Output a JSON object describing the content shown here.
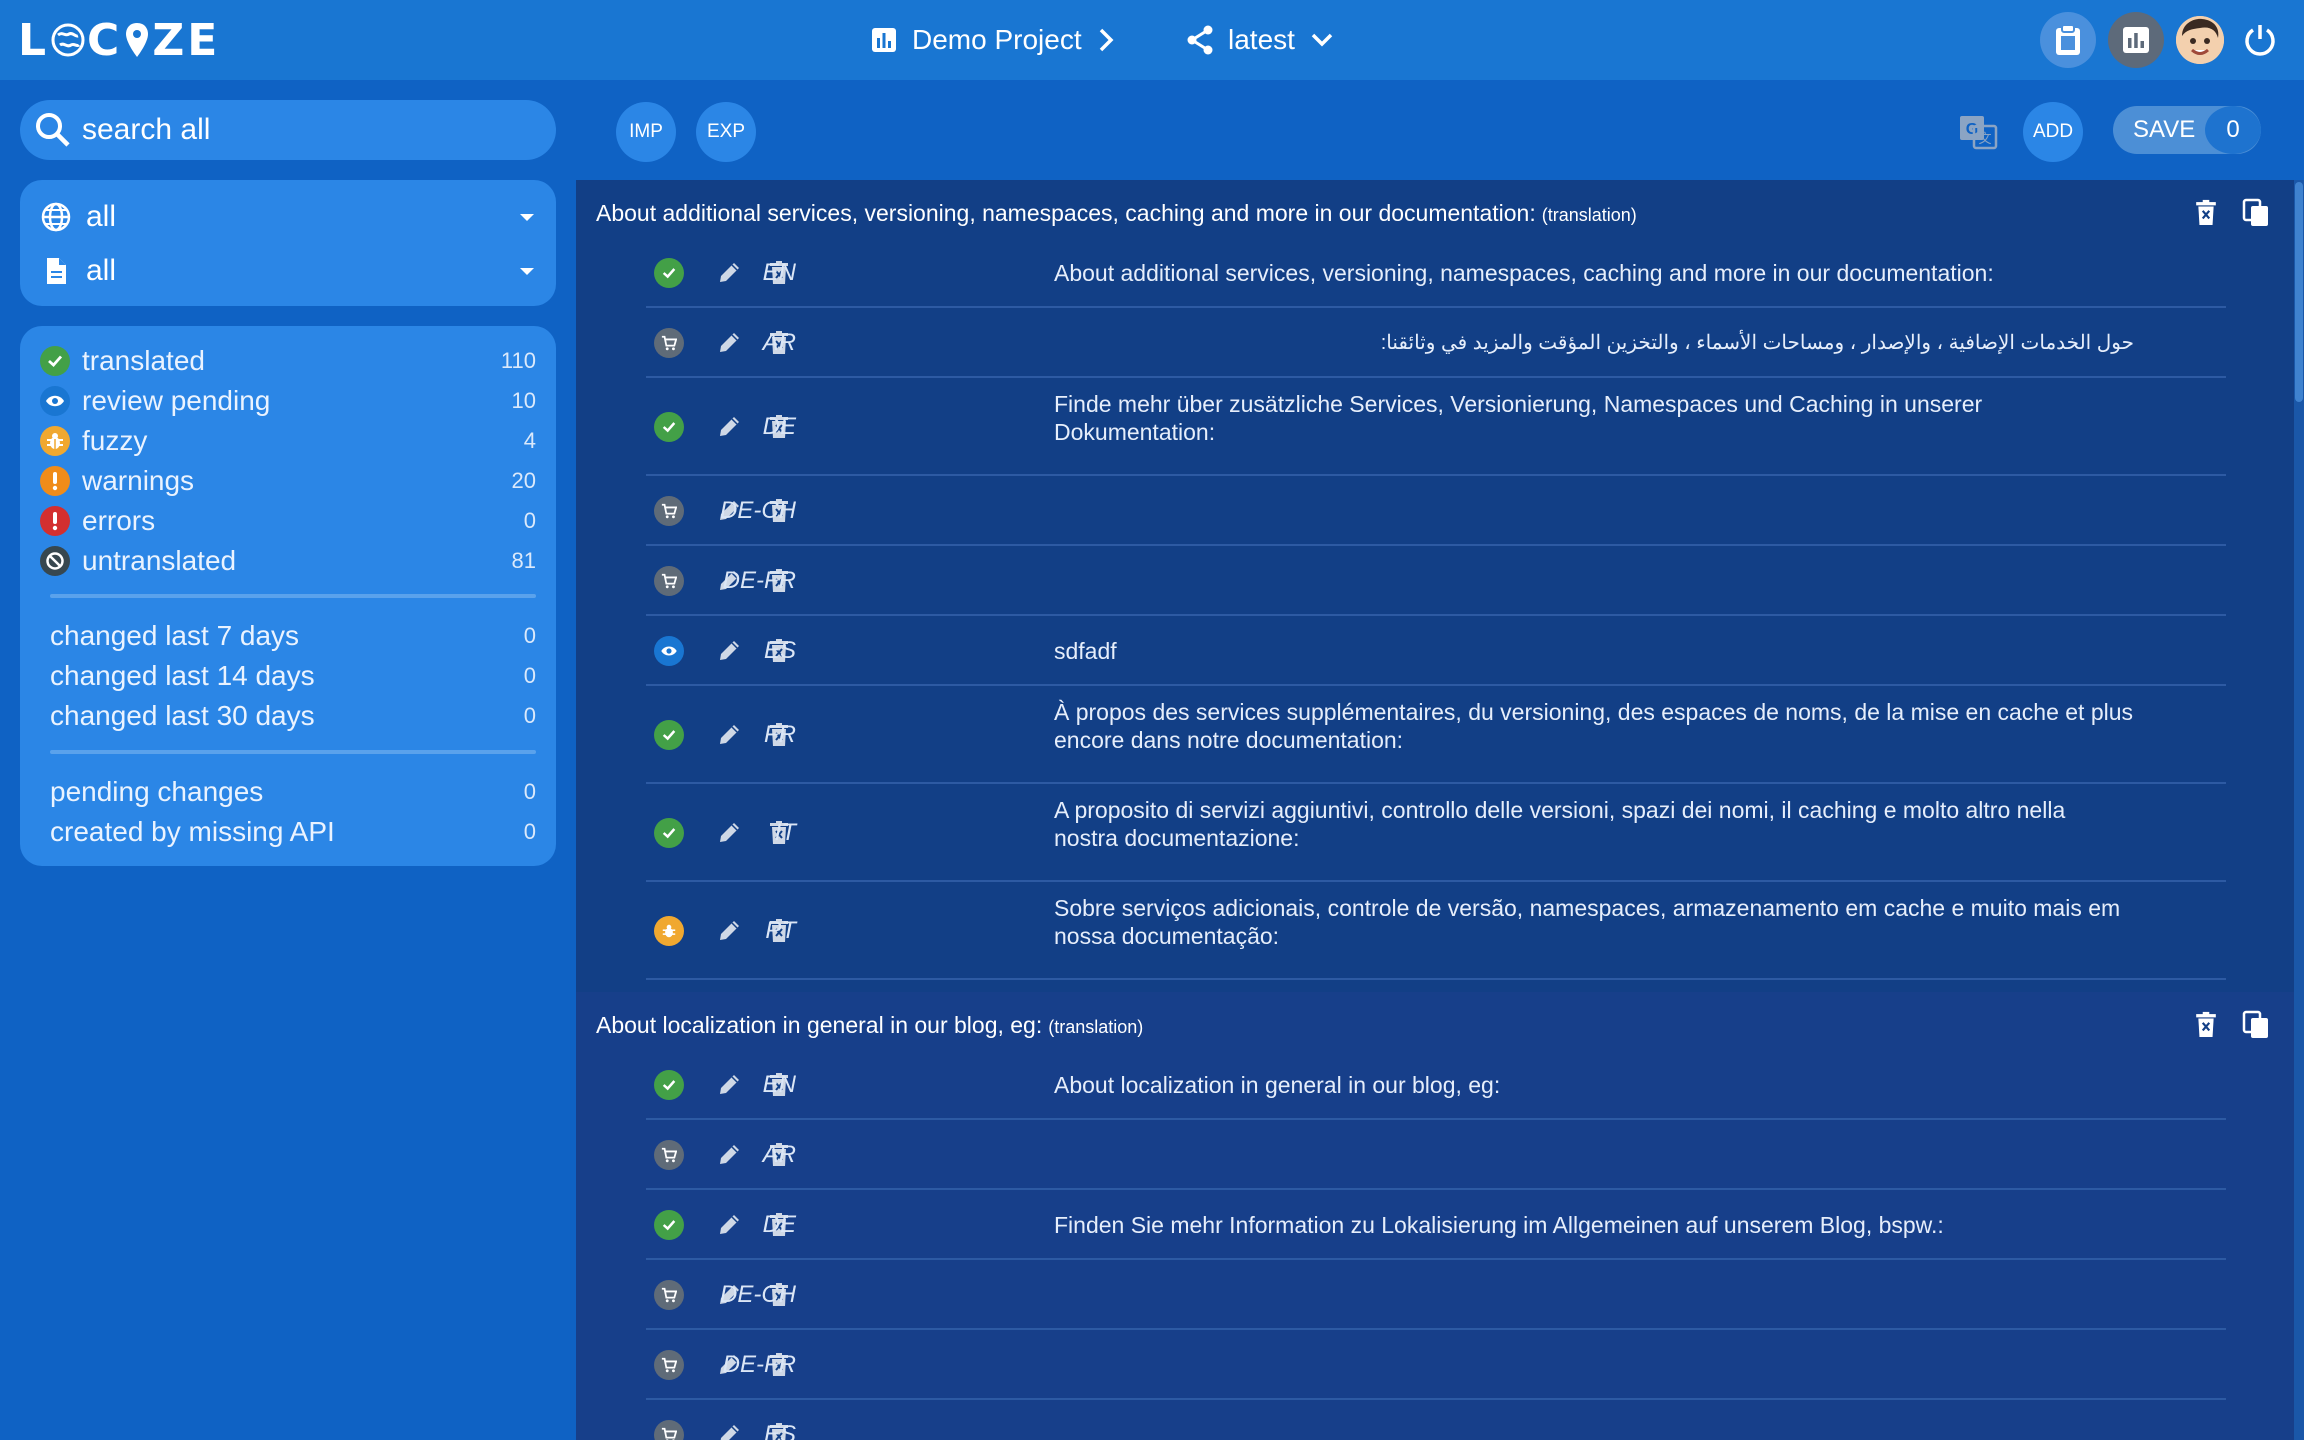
{
  "app": {
    "logo_text": "LOCIZE"
  },
  "header": {
    "project": "Demo Project",
    "version": "latest"
  },
  "sidebar": {
    "search": {
      "placeholder": "search all"
    },
    "filters": {
      "language": "all",
      "namespace": "all"
    },
    "stats": [
      {
        "label": "translated",
        "count": "110",
        "color": "#43a047",
        "icon": "check-icon"
      },
      {
        "label": "review pending",
        "count": "10",
        "color": "#1976d2",
        "icon": "eye-icon"
      },
      {
        "label": "fuzzy",
        "count": "4",
        "color": "#f0a830",
        "icon": "bug-icon"
      },
      {
        "label": "warnings",
        "count": "20",
        "color": "#f08c1a",
        "icon": "exclamation-icon"
      },
      {
        "label": "errors",
        "count": "0",
        "color": "#d32f2f",
        "icon": "exclamation-icon"
      },
      {
        "label": "untranslated",
        "count": "81",
        "color": "#455a64",
        "icon": "ban-icon"
      }
    ],
    "changed": [
      {
        "label": "changed last 7 days",
        "count": "0"
      },
      {
        "label": "changed last 14 days",
        "count": "0"
      },
      {
        "label": "changed last 30 days",
        "count": "0"
      }
    ],
    "other": [
      {
        "label": "pending changes",
        "count": "0"
      },
      {
        "label": "created by missing API",
        "count": "0"
      }
    ]
  },
  "toolbar": {
    "import_label": "IMP",
    "export_label": "EXP",
    "add_label": "ADD",
    "save_label": "SAVE",
    "save_count": "0"
  },
  "colors": {
    "translated": "#43a047",
    "review": "#1976d2",
    "fuzzy": "#f0a830",
    "untranslated": "#5f6b78"
  },
  "keys": [
    {
      "title": "About additional services, versioning, namespaces, caching and more in our documentation:",
      "hint": "(translation)",
      "rows": [
        {
          "lang": "EN",
          "status": "translated",
          "value": "About additional services, versioning, namespaces, caching and more in our documentation:"
        },
        {
          "lang": "AR",
          "status": "untranslated",
          "value": "حول الخدمات الإضافية ، والإصدار ، ومساحات الأسماء ، والتخزين المؤقت والمزيد في وثائقنا:"
        },
        {
          "lang": "DE",
          "status": "translated",
          "value": "Finde mehr über zusätzliche Services, Versionierung, Namespaces und Caching in unserer Dokumentation:"
        },
        {
          "lang": "DE-CH",
          "status": "untranslated",
          "value": ""
        },
        {
          "lang": "DE-FR",
          "status": "untranslated",
          "value": ""
        },
        {
          "lang": "ES",
          "status": "review",
          "value": "sdfadf"
        },
        {
          "lang": "FR",
          "status": "translated",
          "value": "À propos des services supplémentaires, du versioning, des espaces de noms, de la mise en cache et plus encore dans notre documentation:"
        },
        {
          "lang": "IT",
          "status": "translated",
          "value": "A proposito di servizi aggiuntivi, controllo delle versioni, spazi dei nomi, il caching e molto altro nella nostra documentazione:"
        },
        {
          "lang": "PT",
          "status": "fuzzy",
          "value": "Sobre serviços adicionais, controle de versão, namespaces, armazenamento em cache e muito mais em nossa documentação:"
        }
      ]
    },
    {
      "title": "About localization in general in our blog, eg:",
      "hint": "(translation)",
      "rows": [
        {
          "lang": "EN",
          "status": "translated",
          "value": "About localization in general in our blog, eg:"
        },
        {
          "lang": "AR",
          "status": "untranslated",
          "value": ""
        },
        {
          "lang": "DE",
          "status": "translated",
          "value": "Finden Sie mehr Information zu Lokalisierung im Allgemeinen auf unserem Blog, bspw.:"
        },
        {
          "lang": "DE-CH",
          "status": "untranslated",
          "value": ""
        },
        {
          "lang": "DE-FR",
          "status": "untranslated",
          "value": ""
        },
        {
          "lang": "ES",
          "status": "untranslated",
          "value": ""
        }
      ]
    }
  ]
}
